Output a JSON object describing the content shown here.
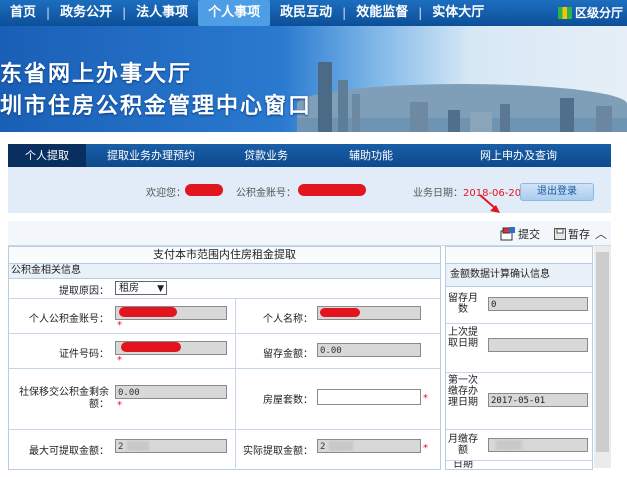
{
  "top_nav": {
    "items": [
      "首页",
      "政务公开",
      "法人事项",
      "个人事项",
      "政民互动",
      "效能监督",
      "实体大厅"
    ],
    "active_index": 3,
    "region_label": "区级分厅"
  },
  "banner": {
    "line1": "东省网上办事大厅",
    "line2": "圳市住房公积金管理中心窗口"
  },
  "sub_nav": {
    "items": [
      "个人提取",
      "提取业务办理预约",
      "贷款业务",
      "辅助功能",
      "网上申办及查询"
    ],
    "active_index": 0
  },
  "info_bar": {
    "welcome_label": "欢迎您：",
    "account_label": "公积金账号：",
    "date_label": "业务日期：",
    "date_value": "2018-06-20",
    "logout_label": "退出登录"
  },
  "toolbar": {
    "submit_label": "提交",
    "save_label": "暂存"
  },
  "form": {
    "title": "支付本市范围内住房租金提取",
    "section_title": "公积金相关信息",
    "reason_label": "提取原因：",
    "reason_value": "租房",
    "account_label": "个人公积金账号：",
    "name_label": "个人名称：",
    "id_label": "证件号码：",
    "balance_label": "留存金额：",
    "balance_value": "0.00",
    "social_label": "社保移交公积金剩余额：",
    "social_value": "0.00",
    "house_count_label": "房屋套数：",
    "max_label": "最大可提取金额：",
    "max_value": "2",
    "actual_label": "实际提取金额：",
    "actual_value": "2"
  },
  "right_panel": {
    "section_title": "金额数据计算确认信息",
    "rows": [
      {
        "label": "留存月数",
        "value": "0"
      },
      {
        "label": "上次提取日期",
        "value": ""
      },
      {
        "label": "第一次缴存办理日期",
        "value": "2017-05-01"
      },
      {
        "label": "月缴存额",
        "value": ""
      },
      {
        "label": "日期",
        "value": ""
      }
    ]
  },
  "colors": {
    "nav_blue": "#0c4f98",
    "accent_red": "#e2141e",
    "info_bg": "#e1ecf8"
  }
}
